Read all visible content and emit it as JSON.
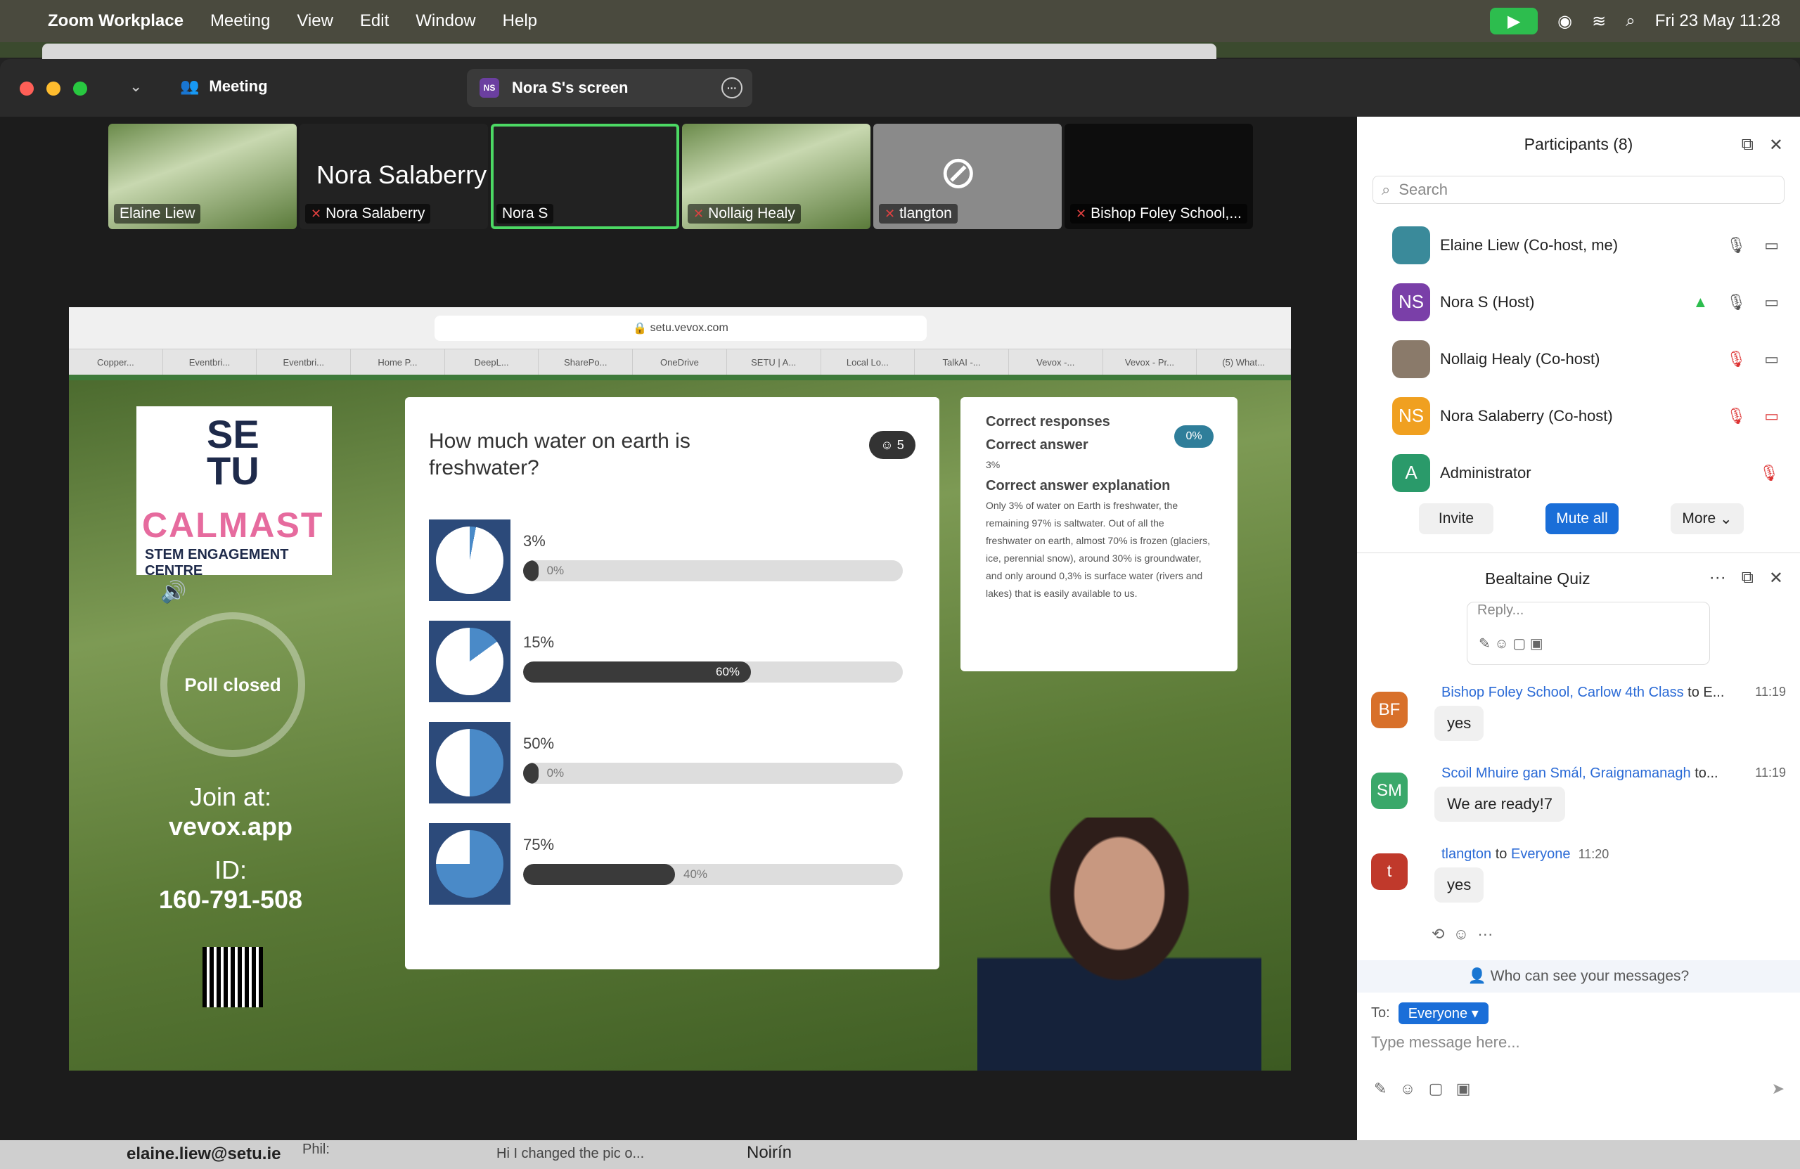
{
  "menubar": {
    "app": "Zoom Workplace",
    "items": [
      "Meeting",
      "View",
      "Edit",
      "Window",
      "Help"
    ],
    "datetime": "Fri 23 May  11:28"
  },
  "window": {
    "meeting_label": "Meeting",
    "screen_label": "Nora S's screen",
    "screen_initials": "NS"
  },
  "thumbnails": [
    {
      "name": "Elaine Liew",
      "muted": false
    },
    {
      "name": "Nora Salaberry",
      "big": "Nora Salaberry",
      "muted": true
    },
    {
      "name": "Nora S",
      "muted": false
    },
    {
      "name": "Nollaig Healy",
      "muted": true
    },
    {
      "name": "tlangton",
      "muted": true
    },
    {
      "name": "Bishop Foley School,...",
      "muted": true
    }
  ],
  "browser": {
    "url": "setu.vevox.com",
    "tabs": [
      "Copper...",
      "Eventbri...",
      "Eventbri...",
      "Home P...",
      "DeepL...",
      "SharePo...",
      "OneDrive",
      "SETU | A...",
      "Local Lo...",
      "TalkAI -...",
      "Vevox -...",
      "Vevox - Pr...",
      "(5) What..."
    ]
  },
  "slide": {
    "logo_setu": "SE\nTU",
    "logo_calmast": "CALMAST",
    "logo_sec": "STEM ENGAGEMENT CENTRE",
    "poll_status": "Poll closed",
    "join_at": "Join at:",
    "join_url": "vevox.app",
    "id_label": "ID:",
    "id_value": "160-791-508"
  },
  "poll": {
    "question": "How much water on earth is freshwater?",
    "responses": "5",
    "options": [
      {
        "label": "3%",
        "pct": "0%",
        "fraction": 0.03,
        "value": 0
      },
      {
        "label": "15%",
        "pct": "60%",
        "fraction": 0.15,
        "value": 60
      },
      {
        "label": "50%",
        "pct": "0%",
        "fraction": 0.5,
        "value": 0
      },
      {
        "label": "75%",
        "pct": "40%",
        "fraction": 0.75,
        "value": 40
      }
    ]
  },
  "explanation": {
    "correct_responses": "Correct responses",
    "correct_pct": "0%",
    "correct_answer_h": "Correct answer",
    "correct_answer": "3%",
    "expl_h": "Correct answer explanation",
    "expl_text": "Only 3% of water on Earth is freshwater, the remaining 97% is saltwater. Out of all the freshwater on earth, almost 70% is frozen (glaciers, ice, perennial snow), around 30% is groundwater, and only around 0,3% is surface water (rivers and lakes) that is easily available to us."
  },
  "participants": {
    "title": "Participants (8)",
    "search": "Search",
    "list": [
      {
        "initials": "",
        "name": "Elaine Liew (Co-host, me)",
        "color": "#3a8a9a"
      },
      {
        "initials": "NS",
        "name": "Nora S (Host)",
        "color": "#7a3fa8"
      },
      {
        "initials": "",
        "name": "Nollaig Healy (Co-host)",
        "color": "#8a7a6a"
      },
      {
        "initials": "NS",
        "name": "Nora Salaberry (Co-host)",
        "color": "#f0a020"
      },
      {
        "initials": "A",
        "name": "Administrator",
        "color": "#2a9a6a"
      }
    ],
    "invite": "Invite",
    "mute_all": "Mute all",
    "more": "More"
  },
  "chat": {
    "title": "Bealtaine Quiz",
    "reply": "Reply...",
    "messages": [
      {
        "initials": "BF",
        "from": "Bishop Foley School, Carlow 4th Class",
        "to": "to E...",
        "time": "11:19",
        "text": "yes",
        "color": "#d8702a"
      },
      {
        "initials": "SM",
        "from": "Scoil Mhuire gan Smál, Graignamanagh",
        "to": "to...",
        "time": "11:19",
        "text": "We are ready!7",
        "color": "#3aa86a"
      },
      {
        "initials": "t",
        "from": "tlangton",
        "to": "to",
        "to2": "Everyone",
        "time": "11:20",
        "text": "yes",
        "color": "#c0392b"
      }
    ],
    "who_can_see": "Who can see your messages?",
    "to_label": "To:",
    "to_value": "Everyone",
    "placeholder": "Type message here..."
  },
  "taskbar": {
    "email": "elaine.liew@setu.ie",
    "phil": "Phil:",
    "snippet": "Hi I changed the pic o...",
    "name": "Noirín"
  }
}
